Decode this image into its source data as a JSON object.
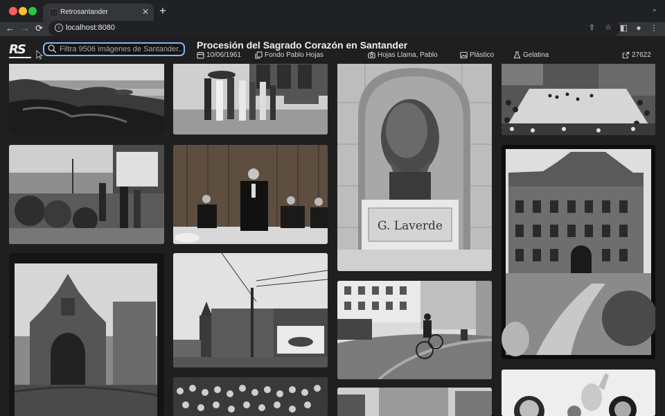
{
  "browser": {
    "tab_title": "Retrosantander",
    "tab_close": "✕",
    "new_tab": "+",
    "url": "localhost:8080",
    "tab_menu": "⌄"
  },
  "icons": {
    "back": "arrow-left-icon",
    "forward": "arrow-right-icon",
    "reload": "reload-icon",
    "share": "share-icon",
    "bookmark": "star-icon",
    "sidepanel": "sidepanel-icon",
    "profile": "profile-icon",
    "menu": "kebab-menu-icon"
  },
  "app": {
    "logo": "RS",
    "search": {
      "placeholder": "Filtra 9506 imágenes de Santander...",
      "value": ""
    },
    "photo": {
      "title": "Procesión del Sagrado Corazón en Santander",
      "date": "10/06/1961",
      "collection": "Fondo Pablo Hojas",
      "author": "Hojas Llama, Pablo",
      "support": "Plástico",
      "process": "Gelatina",
      "id": "27622"
    }
  },
  "gallery": {
    "items": [
      {
        "subject": "rocky coast and sea"
      },
      {
        "subject": "group of people on a street"
      },
      {
        "subject": "bust of G. Laverde",
        "inscription": "G. Laverde"
      },
      {
        "subject": "crowd at procession"
      },
      {
        "subject": "people at flower market"
      },
      {
        "subject": "men at table with wood paneling"
      },
      {
        "subject": "palace facade"
      },
      {
        "subject": "baroque church gate"
      },
      {
        "subject": "buildings with billboard"
      },
      {
        "subject": "cyclist on road"
      },
      {
        "subject": "crowd of people"
      },
      {
        "subject": "trees and buildings"
      },
      {
        "subject": "children with statue"
      }
    ]
  },
  "colors": {
    "background": "#1f1f1f",
    "accent": "#8ab4f8",
    "tabbar": "#202124",
    "toolbar": "#35363a"
  }
}
